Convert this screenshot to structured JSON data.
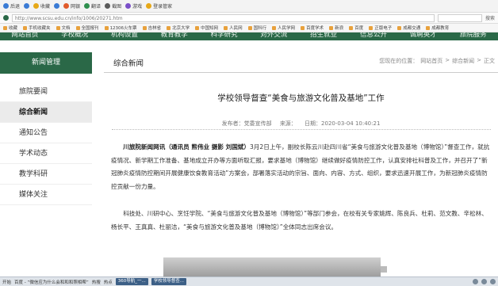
{
  "browser": {
    "toolbar": [
      {
        "label": "后退",
        "icon": "back-arrow-icon",
        "color": "#3a7bd5"
      },
      {
        "label": "",
        "icon": "forward-arrow-icon",
        "color": "#3a7bd5"
      },
      {
        "label": "收藏",
        "icon": "star-icon",
        "color": "#e6a817"
      },
      {
        "label": "",
        "icon": "refresh-icon",
        "color": "#3a7bd5"
      },
      {
        "label": "网银",
        "icon": "bank-icon",
        "color": "#e05a2a"
      },
      {
        "label": "翻译",
        "icon": "translate-icon",
        "color": "#2f8f4e"
      },
      {
        "label": "截图",
        "icon": "scissors-icon",
        "color": "#5a5a5a"
      },
      {
        "label": "游戏",
        "icon": "gamepad-icon",
        "color": "#7a4fc8"
      },
      {
        "label": "登录管家",
        "icon": "key-icon",
        "color": "#e6a817"
      }
    ],
    "url": "http://www.scsu.edu.cn/info/1006/20271.htm",
    "search_value": "",
    "search_button": "搜索",
    "favorites": [
      "收藏",
      "手机收藏夹",
      "文档",
      "全国报刊",
      "12306火车票",
      "吉林省",
      "北京大学",
      "中国知网",
      "人民网",
      "国科行",
      "人民学网",
      "百度学术",
      "新浪",
      "百度",
      "正版电子",
      "成都交通",
      "成都教育"
    ]
  },
  "site_nav": [
    "网站首页",
    "学校概况",
    "机构设置",
    "教育教学",
    "科学研究",
    "对外交流",
    "招生就业",
    "信息公开",
    "诚聘英才",
    "旅院服务"
  ],
  "sidebar": {
    "title": "新闻管理",
    "items": [
      {
        "label": "旅院要闻",
        "active": false
      },
      {
        "label": "综合新闻",
        "active": true
      },
      {
        "label": "通知公告",
        "active": false
      },
      {
        "label": "学术动态",
        "active": false
      },
      {
        "label": "教学科研",
        "active": false
      },
      {
        "label": "媒体关注",
        "active": false
      }
    ]
  },
  "main": {
    "section_title": "综合新闻",
    "breadcrumb": [
      "您现在的位置：",
      "网站首页",
      ">",
      "综合新闻",
      ">",
      "正文"
    ],
    "article": {
      "title": "学校领导督查“美食与旅游文化普及基地”工作",
      "publisher_label": "发布者：",
      "publisher": "党委宣传部",
      "source_label": "来源：",
      "source": "",
      "date_label": "日期：",
      "date": "2020-03-04 10:40:21",
      "lead": "川旅院新闻网讯（通讯员 熊伟业 摄影 刘国斌）",
      "para1": "3月2日上午，副校长陈云川赴四川省“美食与旅游文化普及基地（博物馆）”督查工作，就抗疫情况、新学期工作准备、基地成立开办等方面听取汇报，要求基地（博物馆）继续做好疫情防控工作，认真安排社科普及工作，并召开了“新冠肺炎疫情防控期间开展健康饮食教育活动”方案会，部署落实活动的宗旨、面向、内容、方式、组织，要求迅速开展工作，为新冠肺炎疫情防控贡献一份力量。",
      "para2": "科技处、川研中心、烹饪学院、“美食与旅游文化普及基地（博物馆）”等部门参会，在校有关专家姚辉、陈良兵、杜莉、范文教、辛松林、杨长平、王真真、杜丽洁，“美食与旅游文化普及基地（博物馆）”全体同志出席会议。"
    }
  },
  "taskbar": {
    "items": [
      "开始",
      "百度 - “微信应为什么会和和和照相帮”",
      "热搜",
      "热点"
    ],
    "buttons": [
      "360导航_一...",
      "学校领导督查..."
    ]
  },
  "colors": {
    "brand_green": "#2a6847",
    "sidebar_active_bg": "#ebebeb"
  }
}
